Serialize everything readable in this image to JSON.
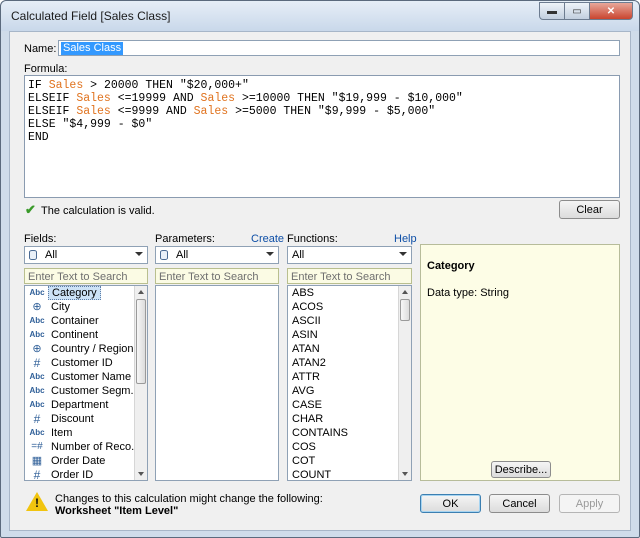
{
  "window": {
    "title": "Calculated Field [Sales Class]",
    "minimize": "▬",
    "maximize": "▭",
    "close": "✕"
  },
  "name": {
    "label": "Name:",
    "value": "Sales Class"
  },
  "formula": {
    "label": "Formula:",
    "lines": [
      [
        {
          "t": "IF ",
          "c": "kw"
        },
        {
          "t": "Sales",
          "c": "fld"
        },
        {
          "t": " > 20000 THEN \"$20,000+\"",
          "c": "kw"
        }
      ],
      [
        {
          "t": "ELSEIF ",
          "c": "kw"
        },
        {
          "t": "Sales",
          "c": "fld"
        },
        {
          "t": " <=19999 AND ",
          "c": "kw"
        },
        {
          "t": "Sales",
          "c": "fld"
        },
        {
          "t": " >=10000 THEN \"$19,999 - $10,000\"",
          "c": "kw"
        }
      ],
      [
        {
          "t": "ELSEIF ",
          "c": "kw"
        },
        {
          "t": "Sales",
          "c": "fld"
        },
        {
          "t": " <=9999 AND ",
          "c": "kw"
        },
        {
          "t": "Sales",
          "c": "fld"
        },
        {
          "t": " >=5000 THEN \"$9,999 - $5,000\"",
          "c": "kw"
        }
      ],
      [
        {
          "t": "ELSE \"$4,999 - $0\"",
          "c": "kw"
        }
      ],
      [
        {
          "t": "END",
          "c": "kw"
        }
      ]
    ]
  },
  "status": {
    "text": "The calculation is valid."
  },
  "clear_button": "Clear",
  "fields": {
    "label": "Fields:",
    "dropdown": "All",
    "search_placeholder": "Enter Text to Search",
    "items": [
      {
        "icon": "Abc",
        "label": "Category",
        "selected": true
      },
      {
        "icon": "geo",
        "label": "City"
      },
      {
        "icon": "Abc",
        "label": "Container"
      },
      {
        "icon": "Abc",
        "label": "Continent"
      },
      {
        "icon": "geo",
        "label": "Country / Region"
      },
      {
        "icon": "#",
        "label": "Customer ID"
      },
      {
        "icon": "Abc",
        "label": "Customer Name"
      },
      {
        "icon": "Abc",
        "label": "Customer Segm..."
      },
      {
        "icon": "Abc",
        "label": "Department"
      },
      {
        "icon": "#",
        "label": "Discount"
      },
      {
        "icon": "Abc",
        "label": "Item"
      },
      {
        "icon": "=#",
        "label": "Number of Reco..."
      },
      {
        "icon": "date",
        "label": "Order Date"
      },
      {
        "icon": "#",
        "label": "Order ID"
      }
    ]
  },
  "parameters": {
    "label": "Parameters:",
    "create_link": "Create",
    "dropdown": "All",
    "search_placeholder": "Enter Text to Search"
  },
  "functions": {
    "label": "Functions:",
    "help_link": "Help",
    "dropdown": "All",
    "search_placeholder": "Enter Text to Search",
    "items": [
      "ABS",
      "ACOS",
      "ASCII",
      "ASIN",
      "ATAN",
      "ATAN2",
      "ATTR",
      "AVG",
      "CASE",
      "CHAR",
      "CONTAINS",
      "COS",
      "COT",
      "COUNT"
    ]
  },
  "description": {
    "title": "Category",
    "data_type": "Data type: String",
    "describe_button": "Describe..."
  },
  "footer": {
    "warning_line1": "Changes to this calculation might change the following:",
    "warning_line2": "Worksheet \"Item Level\"",
    "ok": "OK",
    "cancel": "Cancel",
    "apply": "Apply"
  },
  "colors": {
    "field_ref": "#e0731f",
    "selection": "#3399ff",
    "valid_check": "#3a9a2a"
  }
}
